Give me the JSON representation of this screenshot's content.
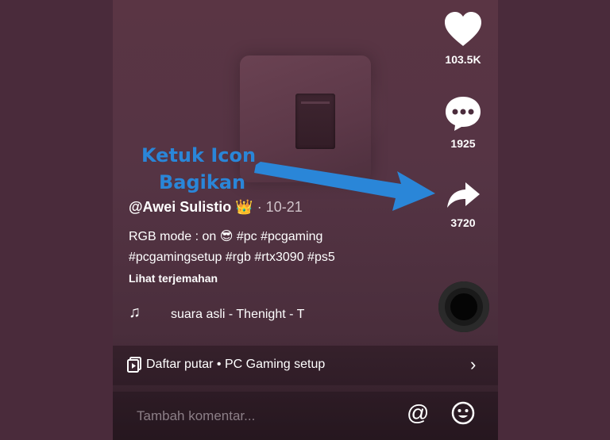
{
  "annotation": {
    "line1": "Ketuk Icon",
    "line2": "Bagikan"
  },
  "actions": {
    "likes": "103.5K",
    "comments": "1925",
    "shares": "3720"
  },
  "post": {
    "username": "@Awei Sulistio",
    "crown": "👑",
    "date": " · 10-21",
    "caption_line1": "RGB mode : on 😎 #pc #pcgaming",
    "caption_line2": "#pcgamingsetup #rgb #rtx3090 #ps5",
    "translate": "Lihat terjemahan",
    "music": "suara asli - Thenight - T"
  },
  "playlist": {
    "label": "Daftar putar • PC Gaming setup"
  },
  "comment": {
    "placeholder": "Tambah komentar..."
  },
  "colors": {
    "annotation": "#2a86d8",
    "background": "#4b2c3c"
  },
  "icons": [
    "heart-icon",
    "comment-icon",
    "share-icon",
    "music-note-icon",
    "playlist-icon",
    "chevron-right-icon",
    "mention-icon",
    "emoji-icon"
  ]
}
